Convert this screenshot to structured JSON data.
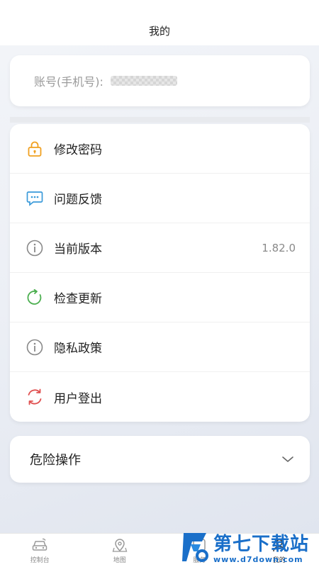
{
  "header": {
    "title": "我的"
  },
  "account": {
    "label": "账号(手机号):"
  },
  "menu": {
    "items": [
      {
        "label": "修改密码",
        "icon": "lock-icon",
        "color": "#f0a020"
      },
      {
        "label": "问题反馈",
        "icon": "chat-icon",
        "color": "#3a9ad9"
      },
      {
        "label": "当前版本",
        "icon": "info-icon",
        "color": "#888888",
        "value": "1.82.0"
      },
      {
        "label": "检查更新",
        "icon": "refresh-icon",
        "color": "#4caf50"
      },
      {
        "label": "隐私政策",
        "icon": "info-icon",
        "color": "#888888"
      },
      {
        "label": "用户登出",
        "icon": "logout-cycle-icon",
        "color": "#e05050"
      }
    ]
  },
  "danger": {
    "label": "危险操作",
    "icon": "chevron-down-icon"
  },
  "tabbar": {
    "tabs": [
      {
        "label": "控制台",
        "icon": "car-icon"
      },
      {
        "label": "地图",
        "icon": "map-pin-icon"
      },
      {
        "label": "服务",
        "icon": "service-icon"
      },
      {
        "label": "我的",
        "icon": "user-icon",
        "active": true
      }
    ]
  },
  "watermark": {
    "title": "第七下载站",
    "url": "www.d7down.com"
  }
}
